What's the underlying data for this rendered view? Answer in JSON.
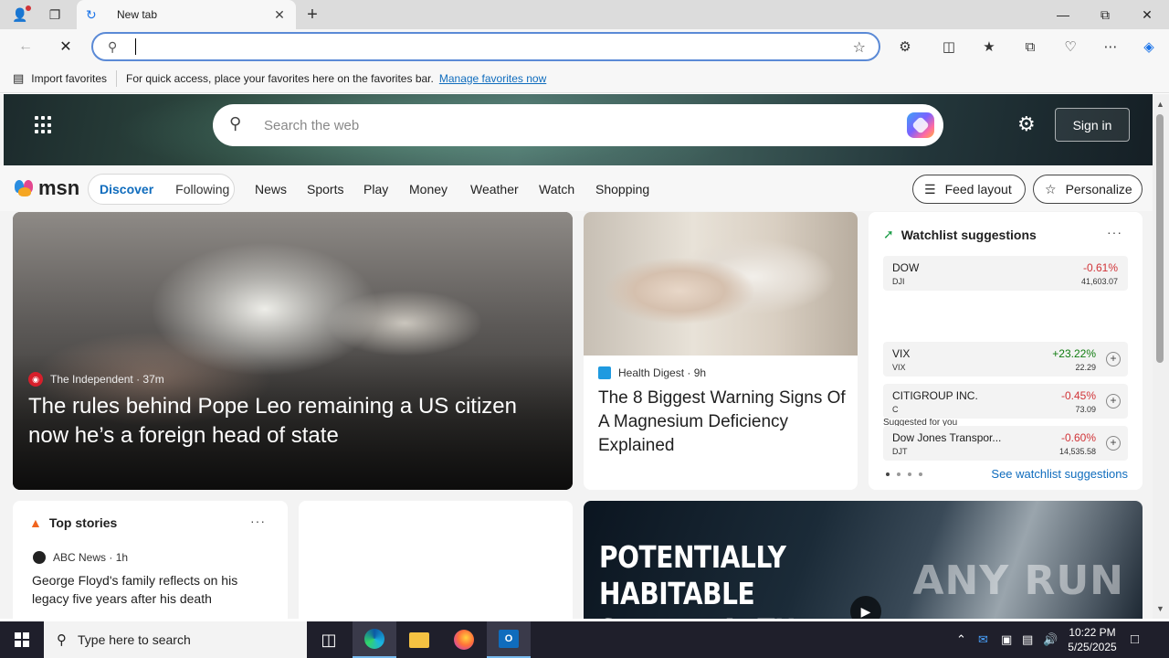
{
  "browser": {
    "tab_title": "New tab",
    "address_value": "",
    "favorites": {
      "import_label": "Import favorites",
      "hint": "For quick access, place your favorites here on the favorites bar.",
      "manage_link": "Manage favorites now"
    }
  },
  "msn": {
    "search_placeholder": "Search the web",
    "sign_in": "Sign in",
    "logo_text": "msn",
    "feed_tabs": [
      "Discover",
      "Following"
    ],
    "nav_links": [
      "News",
      "Sports",
      "Play",
      "Money",
      "Weather",
      "Watch",
      "Shopping"
    ],
    "feed_layout": "Feed layout",
    "personalize": "Personalize",
    "main_story": {
      "source": "The Independent",
      "age": "· 37m",
      "headline": "The rules behind Pope Leo remaining a US citizen now he’s a foreign head of state"
    },
    "health_story": {
      "source": "Health Digest",
      "age": "· 9h",
      "headline": "The 8 Biggest Warning Signs Of A Magnesium Deficiency Explained"
    },
    "watchlist": {
      "title": "Watchlist suggestions",
      "more": "···",
      "suggested_label": "Suggested for you",
      "see_more": "See watchlist suggestions",
      "items": [
        {
          "name": "DOW",
          "symbol": "DJI",
          "change": "-0.61%",
          "price": "41,603.07",
          "direction": "down"
        },
        {
          "name": "VIX",
          "symbol": "VIX",
          "change": "+23.22%",
          "price": "22.29",
          "direction": "up"
        },
        {
          "name": "CITIGROUP INC.",
          "symbol": "C",
          "change": "-0.45%",
          "price": "73.09",
          "direction": "down"
        },
        {
          "name": "Dow Jones Transpor...",
          "symbol": "DJT",
          "change": "-0.60%",
          "price": "14,535.58",
          "direction": "down"
        }
      ]
    },
    "top_stories": {
      "title": "Top stories",
      "more": "···",
      "source": "ABC News",
      "age": "· 1h",
      "headline": "George Floyd's family reflects on his legacy five years after his death"
    },
    "video": {
      "title": "POTENTIALLY HABITABLE SUPER-EARTH DISCOVERY",
      "watermark": "ANY RUN"
    }
  },
  "taskbar": {
    "search_placeholder": "Type here to search",
    "time": "10:22 PM",
    "date": "5/25/2025"
  },
  "colors": {
    "accent": "#0f6cbd",
    "negative": "#d13438",
    "positive": "#107c10"
  }
}
